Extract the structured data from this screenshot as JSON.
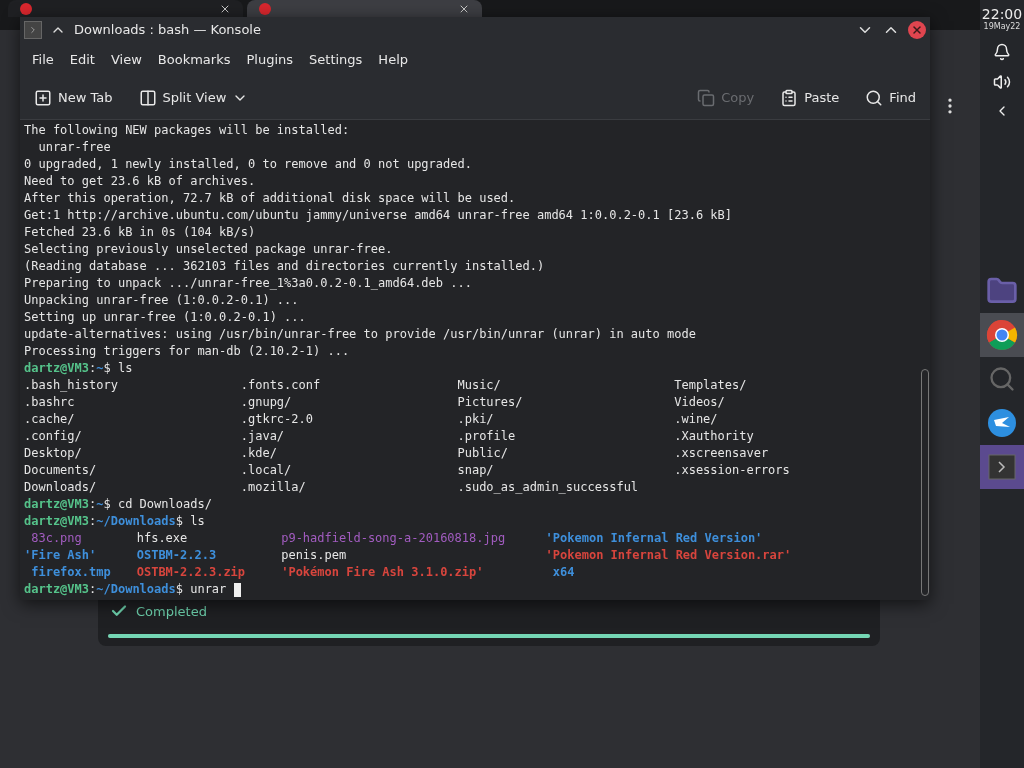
{
  "browser": {
    "tabs": [
      {
        "selected": false
      },
      {
        "selected": true
      }
    ],
    "download": {
      "status": "Completed",
      "level": 1
    }
  },
  "tray": {
    "time": "22:00",
    "date": "19May22"
  },
  "taskbar": {
    "items": [
      {
        "kind": "folder",
        "selected": false
      },
      {
        "kind": "chrome",
        "selected": true
      },
      {
        "kind": "search",
        "selected": false
      },
      {
        "kind": "bird",
        "selected": false
      },
      {
        "kind": "terminal",
        "selected": true
      }
    ]
  },
  "window": {
    "title": "Downloads : bash — Konsole",
    "menu": [
      "File",
      "Edit",
      "View",
      "Bookmarks",
      "Plugins",
      "Settings",
      "Help"
    ],
    "toolbar": [
      {
        "kind": "newtab",
        "label": "New Tab",
        "disabled": false
      },
      {
        "kind": "split",
        "label": "Split View",
        "disabled": false
      },
      {
        "kind": "copy",
        "label": "Copy",
        "disabled": true
      },
      {
        "kind": "paste",
        "label": "Paste",
        "disabled": false
      },
      {
        "kind": "find",
        "label": "Find",
        "disabled": false
      }
    ],
    "terminal": [
      {
        "kind": "text",
        "text": "The following NEW packages will be installed:"
      },
      {
        "kind": "text",
        "text": "  unrar-free"
      },
      {
        "kind": "text",
        "text": "0 upgraded, 1 newly installed, 0 to remove and 0 not upgraded."
      },
      {
        "kind": "text",
        "text": "Need to get 23.6 kB of archives."
      },
      {
        "kind": "text",
        "text": "After this operation, 72.7 kB of additional disk space will be used."
      },
      {
        "kind": "text",
        "text": "Get:1 http://archive.ubuntu.com/ubuntu jammy/universe amd64 unrar-free amd64 1:0.0.2-0.1 [23.6 kB]"
      },
      {
        "kind": "text",
        "text": "Fetched 23.6 kB in 0s (104 kB/s)"
      },
      {
        "kind": "text",
        "text": "Selecting previously unselected package unrar-free."
      },
      {
        "kind": "text",
        "text": "(Reading database ... 362103 files and directories currently installed.)"
      },
      {
        "kind": "text",
        "text": "Preparing to unpack .../unrar-free_1%3a0.0.2-0.1_amd64.deb ..."
      },
      {
        "kind": "text",
        "text": "Unpacking unrar-free (1:0.0.2-0.1) ..."
      },
      {
        "kind": "text",
        "text": "Setting up unrar-free (1:0.0.2-0.1) ..."
      },
      {
        "kind": "text",
        "text": "update-alternatives: using /usr/bin/unrar-free to provide /usr/bin/unrar (unrar) in auto mode"
      },
      {
        "kind": "text",
        "text": "Processing triggers for man-db (2.10.2-1) ..."
      },
      {
        "kind": "prompt",
        "user": "dartz@VM3",
        "sep": ":",
        "path": "~",
        "command": "$ ls",
        "cursor": false
      },
      {
        "kind": "lswide",
        "cells": [
          {
            "text": ".bash_history",
            "kind": "file"
          },
          {
            "text": ".fonts.conf",
            "kind": "file"
          },
          {
            "text": "Music/",
            "kind": "file"
          },
          {
            "text": "Templates/",
            "kind": "file"
          }
        ]
      },
      {
        "kind": "lswide",
        "cells": [
          {
            "text": ".bashrc",
            "kind": "file"
          },
          {
            "text": ".gnupg/",
            "kind": "file"
          },
          {
            "text": "Pictures/",
            "kind": "file"
          },
          {
            "text": "Videos/",
            "kind": "file"
          }
        ]
      },
      {
        "kind": "lswide",
        "cells": [
          {
            "text": ".cache/",
            "kind": "file"
          },
          {
            "text": ".gtkrc-2.0",
            "kind": "file"
          },
          {
            "text": ".pki/",
            "kind": "file"
          },
          {
            "text": ".wine/",
            "kind": "file"
          }
        ]
      },
      {
        "kind": "lswide",
        "cells": [
          {
            "text": ".config/",
            "kind": "file"
          },
          {
            "text": ".java/",
            "kind": "file"
          },
          {
            "text": ".profile",
            "kind": "file"
          },
          {
            "text": ".Xauthority",
            "kind": "file"
          }
        ]
      },
      {
        "kind": "lswide",
        "cells": [
          {
            "text": "Desktop/",
            "kind": "file"
          },
          {
            "text": ".kde/",
            "kind": "file"
          },
          {
            "text": "Public/",
            "kind": "file"
          },
          {
            "text": ".xscreensaver",
            "kind": "file"
          }
        ]
      },
      {
        "kind": "lswide",
        "cells": [
          {
            "text": "Documents/",
            "kind": "file"
          },
          {
            "text": ".local/",
            "kind": "file"
          },
          {
            "text": "snap/",
            "kind": "file"
          },
          {
            "text": ".xsession-errors",
            "kind": "file"
          }
        ]
      },
      {
        "kind": "lswide",
        "cells": [
          {
            "text": "Downloads/",
            "kind": "file"
          },
          {
            "text": ".mozilla/",
            "kind": "file"
          },
          {
            "text": ".sudo_as_admin_successful",
            "kind": "file"
          }
        ]
      },
      {
        "kind": "prompt",
        "user": "dartz@VM3",
        "sep": ":",
        "path": "~",
        "command": "$ cd Downloads/",
        "cursor": false
      },
      {
        "kind": "prompt",
        "user": "dartz@VM3",
        "sep": ":",
        "path": "~/Downloads",
        "command": "$ ls",
        "cursor": false
      },
      {
        "kind": "lsnarrow",
        "cells": [
          {
            "text": " 83c.png",
            "kind": "image"
          },
          {
            "text": "hfs.exe",
            "kind": "file"
          },
          {
            "text": "p9-hadfield-song-a-20160818.jpg",
            "kind": "image"
          },
          {
            "text": "'Pokemon Infernal Red Version'",
            "kind": "dir"
          }
        ]
      },
      {
        "kind": "lsnarrow",
        "cells": [
          {
            "text": "'Fire Ash'",
            "kind": "dir"
          },
          {
            "text": "OSTBM-2.2.3",
            "kind": "dir"
          },
          {
            "text": "penis.pem",
            "kind": "file"
          },
          {
            "text": "'Pokemon Infernal Red Version.rar'",
            "kind": "archive"
          }
        ]
      },
      {
        "kind": "lsnarrow",
        "cells": [
          {
            "text": " firefox.tmp",
            "kind": "dir"
          },
          {
            "text": "OSTBM-2.2.3.zip",
            "kind": "archive"
          },
          {
            "text": "'Pokémon Fire Ash 3.1.0.zip'",
            "kind": "archive"
          },
          {
            "text": " x64",
            "kind": "dir"
          }
        ]
      },
      {
        "kind": "prompt",
        "user": "dartz@VM3",
        "sep": ":",
        "path": "~/Downloads",
        "command": "$ unrar",
        "cursor": true
      }
    ]
  }
}
